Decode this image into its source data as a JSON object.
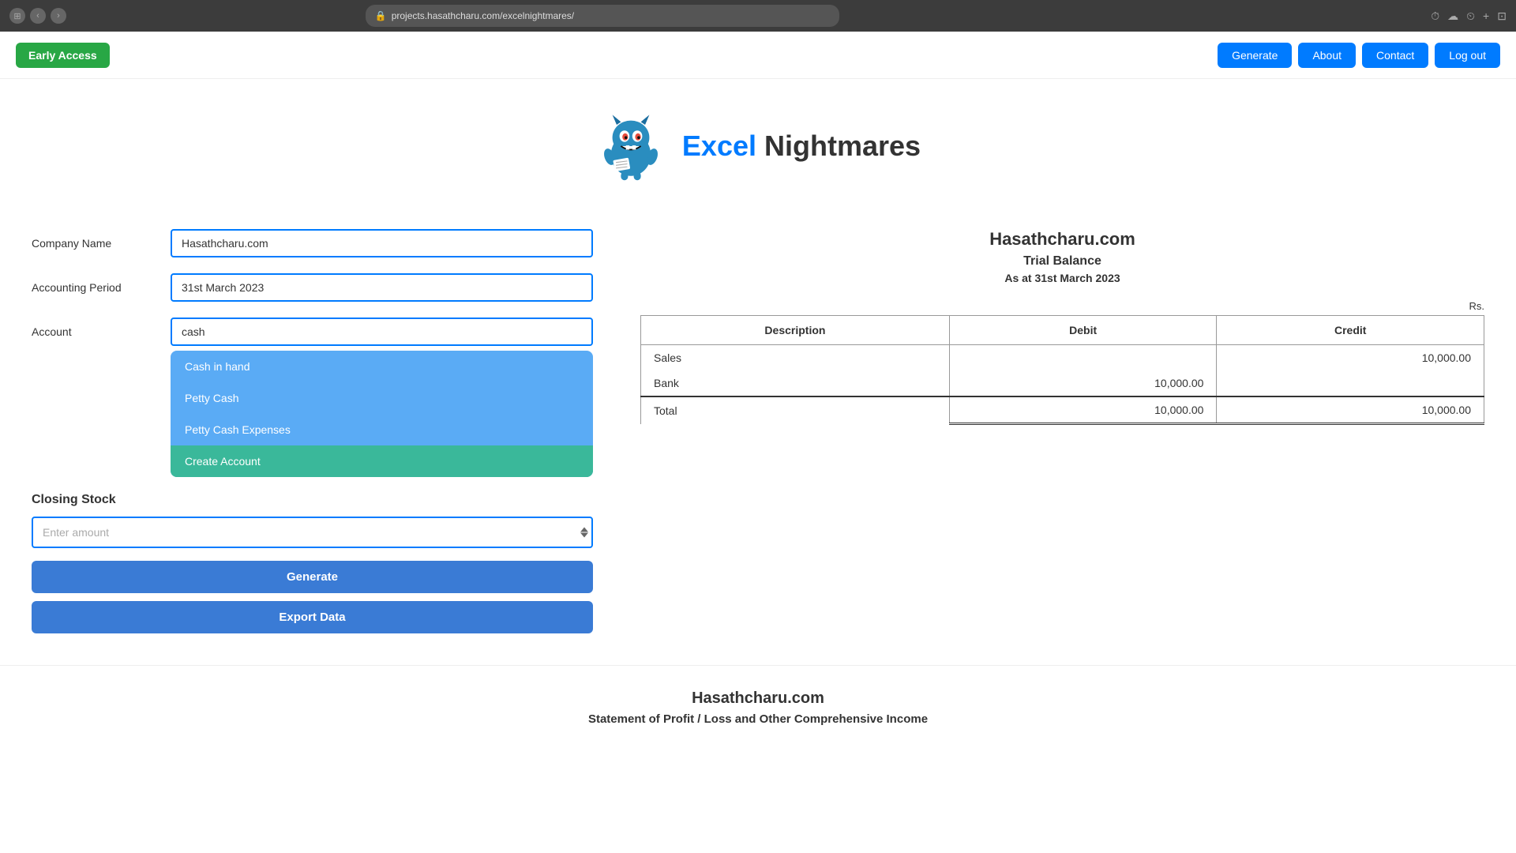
{
  "browser": {
    "url": "projects.hasathcharu.com/excelnightmares/",
    "lock_icon": "🔒"
  },
  "nav": {
    "early_access": "Early Access",
    "generate": "Generate",
    "about": "About",
    "contact": "Contact",
    "logout": "Log out"
  },
  "hero": {
    "title_excel": "Excel",
    "title_rest": " Nightmares"
  },
  "form": {
    "company_label": "Company Name",
    "company_value": "Hasathcharu.com",
    "period_label": "Accounting Period",
    "period_value": "31st March 2023",
    "account_label": "Account",
    "account_value": "cash"
  },
  "dropdown": {
    "items": [
      {
        "label": "Cash in hand",
        "selected": false
      },
      {
        "label": "Petty Cash",
        "selected": false
      },
      {
        "label": "Petty Cash Expenses",
        "selected": false
      },
      {
        "label": "Create Account",
        "selected": true
      }
    ]
  },
  "closing_stock": {
    "label": "Closing Stock",
    "placeholder": "Enter amount"
  },
  "buttons": {
    "generate": "Generate",
    "export": "Export Data"
  },
  "trial_balance": {
    "company": "Hasathcharu.com",
    "title": "Trial Balance",
    "date": "As at 31st March 2023",
    "currency": "Rs.",
    "columns": [
      "Description",
      "Debit",
      "Credit"
    ],
    "rows": [
      {
        "description": "Sales",
        "debit": "",
        "credit": "10,000.00"
      },
      {
        "description": "Bank",
        "debit": "10,000.00",
        "credit": ""
      },
      {
        "description": "Total",
        "debit": "10,000.00",
        "credit": "10,000.00"
      }
    ]
  },
  "bottom": {
    "company": "Hasathcharu.com",
    "statement": "Statement of Profit / Loss and Other Comprehensive Income"
  }
}
